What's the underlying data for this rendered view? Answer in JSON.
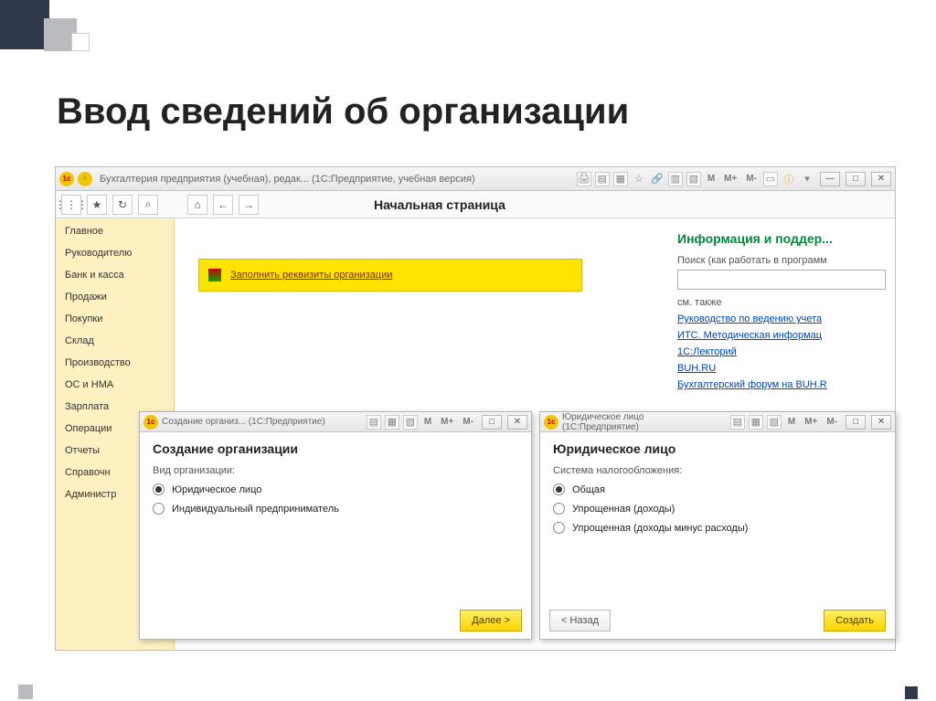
{
  "slide": {
    "title": "Ввод сведений об организации"
  },
  "main_window": {
    "title": "Бухгалтерия предприятия (учебная), редак...   (1С:Предприятие, учебная версия)",
    "toolbar_text_icons": {
      "m": "М",
      "m_plus": "М+",
      "m_minus": "М-"
    },
    "page_title": "Начальная страница",
    "nav_icons": {
      "grid": "⋮⋮⋮",
      "star": "★",
      "history": "↻",
      "search": "⌕",
      "home": "⌂",
      "back": "←",
      "fwd": "→"
    }
  },
  "sidebar": {
    "items": [
      {
        "label": "Главное"
      },
      {
        "label": "Руководителю"
      },
      {
        "label": "Банк и касса"
      },
      {
        "label": "Продажи"
      },
      {
        "label": "Покупки"
      },
      {
        "label": "Склад"
      },
      {
        "label": "Производство"
      },
      {
        "label": "ОС и НМА"
      },
      {
        "label": "Зарплата"
      },
      {
        "label": "Операции"
      },
      {
        "label": "Отчеты"
      },
      {
        "label": "Справочн"
      },
      {
        "label": "Администр"
      }
    ]
  },
  "banner": {
    "link": "Заполнить реквизиты организации"
  },
  "right_panel": {
    "heading": "Информация и поддер...",
    "search_label": "Поиск (как работать в программ",
    "search_value": "",
    "see_also": "см. также",
    "links": [
      "Руководство по ведению учета",
      "ИТС. Методическая информац",
      "1С:Лекторий",
      "BUH.RU",
      "Бухгалтерский форум на BUH.R"
    ]
  },
  "dialog1": {
    "titlebar": "Создание организ... (1С:Предприятие)",
    "title": "Создание организации",
    "field_label": "Вид организации:",
    "options": [
      {
        "label": "Юридическое лицо",
        "selected": true
      },
      {
        "label": "Индивидуальный предприниматель",
        "selected": false
      }
    ],
    "next_btn": "Далее >"
  },
  "dialog2": {
    "titlebar": "Юридическое лицо (1С:Предприятие)",
    "title": "Юридическое лицо",
    "field_label": "Система налогообложения:",
    "options": [
      {
        "label": "Общая",
        "selected": true
      },
      {
        "label": "Упрощенная (доходы)",
        "selected": false
      },
      {
        "label": "Упрощенная (доходы минус расходы)",
        "selected": false
      }
    ],
    "back_btn": "< Назад",
    "create_btn": "Создать"
  }
}
